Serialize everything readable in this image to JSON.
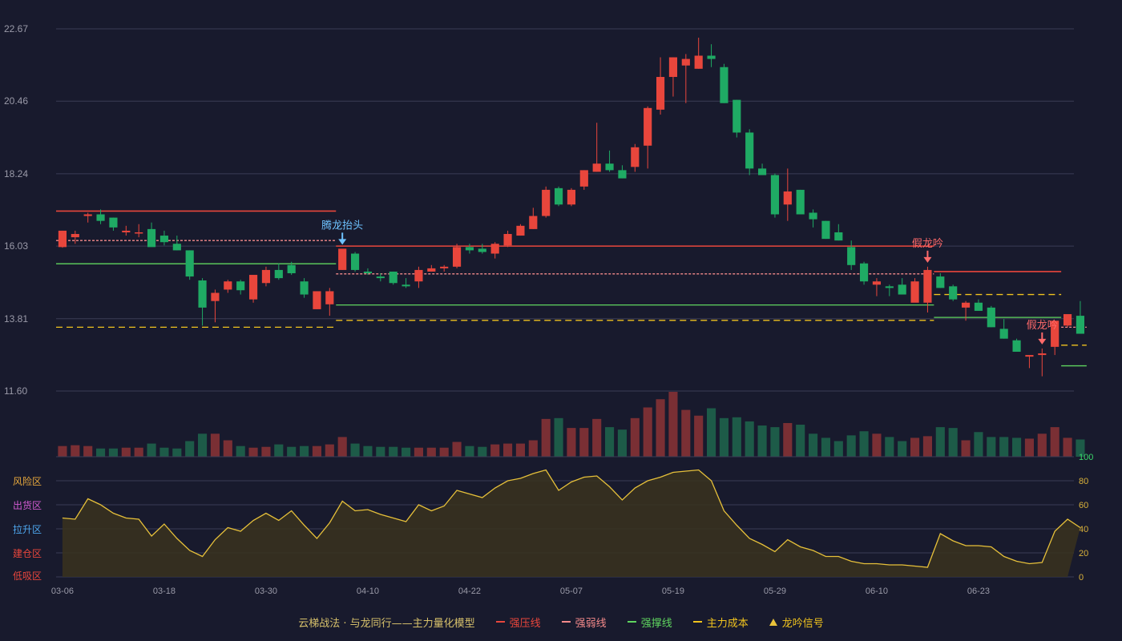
{
  "colors": {
    "background": "#181a2d",
    "grid": "#3a3c55",
    "axis_text": "#9a9aa8",
    "up": "#e8463c",
    "down": "#1faa64",
    "resist": "#e8463c",
    "weak": "#f48a8a",
    "support": "#5fd55f",
    "cost": "#f0c31e",
    "osc_line": "#e6c03a",
    "signal_blue": "#6ec3ff",
    "signal_red": "#ff6a6a"
  },
  "chart_data": {
    "type": "candlestick",
    "dates": [
      "03-06",
      "03-07",
      "03-10",
      "03-11",
      "03-12",
      "03-13",
      "03-14",
      "03-17",
      "03-18",
      "03-19",
      "03-20",
      "03-21",
      "03-24",
      "03-25",
      "03-26",
      "03-27",
      "03-28",
      "03-31",
      "04-01",
      "04-02",
      "04-03",
      "04-07",
      "04-08",
      "04-09",
      "04-10",
      "04-11",
      "04-14",
      "04-15",
      "04-16",
      "04-17",
      "04-18",
      "04-21",
      "04-22",
      "04-23",
      "04-24",
      "04-25",
      "04-28",
      "04-29",
      "04-30",
      "05-06",
      "05-07",
      "05-08",
      "05-09",
      "05-12",
      "05-13",
      "05-14",
      "05-15",
      "05-16",
      "05-19",
      "05-20",
      "05-21",
      "05-22",
      "05-23",
      "05-26",
      "05-27",
      "05-28",
      "05-29",
      "05-30",
      "06-03",
      "06-04",
      "06-05",
      "06-06",
      "06-09",
      "06-10",
      "06-11",
      "06-12",
      "06-13",
      "06-16",
      "06-17",
      "06-18",
      "06-19",
      "06-20",
      "06-23",
      "06-24",
      "06-25",
      "06-26",
      "06-27",
      "06-30",
      "07-01",
      "07-02"
    ],
    "x_tick_labels": [
      "03-06",
      "03-18",
      "03-30",
      "04-10",
      "04-22",
      "05-07",
      "05-19",
      "05-29",
      "06-10",
      "06-23"
    ],
    "x_tick_index": [
      0,
      8,
      16,
      24,
      32,
      40,
      48,
      56,
      64,
      72
    ],
    "y_tick_labels": [
      "22.67",
      "20.46",
      "18.24",
      "16.03",
      "13.81",
      "11.60"
    ],
    "ylim": [
      11.6,
      22.67
    ],
    "ohlc": [
      [
        16.0,
        16.5,
        15.98,
        16.5
      ],
      [
        16.3,
        16.5,
        16.1,
        16.4
      ],
      [
        16.95,
        17.05,
        16.75,
        17.0
      ],
      [
        17.0,
        17.15,
        16.7,
        16.8
      ],
      [
        16.9,
        16.9,
        16.5,
        16.6
      ],
      [
        16.45,
        16.65,
        16.35,
        16.5
      ],
      [
        16.45,
        16.7,
        16.3,
        16.45
      ],
      [
        16.55,
        16.75,
        16.05,
        16.0
      ],
      [
        16.15,
        16.5,
        16.05,
        16.35
      ],
      [
        16.1,
        16.35,
        15.9,
        15.9
      ],
      [
        15.9,
        15.9,
        15.0,
        15.1
      ],
      [
        14.98,
        15.05,
        13.6,
        14.15
      ],
      [
        14.35,
        14.7,
        13.7,
        14.6
      ],
      [
        14.7,
        15.0,
        14.6,
        14.95
      ],
      [
        14.95,
        15.0,
        14.55,
        14.68
      ],
      [
        14.4,
        15.1,
        14.3,
        15.15
      ],
      [
        14.9,
        15.4,
        14.8,
        15.3
      ],
      [
        15.3,
        15.5,
        15.0,
        15.05
      ],
      [
        15.45,
        15.55,
        15.15,
        15.2
      ],
      [
        14.95,
        15.05,
        14.45,
        14.55
      ],
      [
        14.1,
        14.65,
        14.1,
        14.65
      ],
      [
        14.25,
        14.75,
        13.9,
        14.65
      ],
      [
        15.3,
        15.5,
        15.3,
        15.95
      ],
      [
        15.8,
        15.85,
        15.25,
        15.3
      ],
      [
        15.25,
        15.35,
        15.15,
        15.2
      ],
      [
        15.1,
        15.2,
        14.95,
        15.05
      ],
      [
        15.25,
        15.25,
        14.85,
        14.9
      ],
      [
        14.85,
        15.05,
        14.75,
        14.8
      ],
      [
        14.95,
        15.4,
        14.75,
        15.3
      ],
      [
        15.25,
        15.45,
        15.25,
        15.35
      ],
      [
        15.35,
        15.45,
        15.25,
        15.4
      ],
      [
        15.4,
        16.1,
        15.35,
        16.0
      ],
      [
        16.0,
        16.1,
        15.8,
        15.9
      ],
      [
        15.95,
        16.1,
        15.8,
        15.85
      ],
      [
        15.8,
        16.15,
        15.65,
        16.1
      ],
      [
        16.05,
        16.5,
        16.0,
        16.4
      ],
      [
        16.35,
        16.7,
        16.35,
        16.65
      ],
      [
        16.55,
        17.2,
        16.55,
        16.95
      ],
      [
        16.95,
        17.85,
        16.9,
        17.75
      ],
      [
        17.8,
        17.85,
        17.25,
        17.3
      ],
      [
        17.3,
        17.8,
        17.25,
        17.75
      ],
      [
        17.85,
        18.35,
        17.75,
        18.35
      ],
      [
        18.3,
        19.8,
        18.3,
        18.55
      ],
      [
        18.55,
        18.95,
        18.3,
        18.35
      ],
      [
        18.35,
        18.5,
        18.1,
        18.1
      ],
      [
        18.45,
        19.15,
        18.3,
        19.05
      ],
      [
        19.1,
        20.3,
        18.4,
        20.25
      ],
      [
        20.2,
        21.8,
        20.05,
        21.2
      ],
      [
        21.2,
        21.8,
        20.6,
        21.8
      ],
      [
        21.55,
        21.9,
        20.4,
        21.75
      ],
      [
        21.45,
        22.4,
        21.45,
        21.85
      ],
      [
        21.85,
        22.2,
        21.5,
        21.75
      ],
      [
        21.5,
        21.6,
        20.4,
        20.4
      ],
      [
        20.5,
        20.5,
        19.35,
        19.5
      ],
      [
        19.5,
        19.6,
        18.2,
        18.4
      ],
      [
        18.4,
        18.55,
        18.2,
        18.2
      ],
      [
        18.2,
        18.25,
        16.9,
        17.0
      ],
      [
        17.3,
        18.4,
        16.8,
        17.7
      ],
      [
        17.75,
        17.75,
        17.0,
        17.0
      ],
      [
        17.05,
        17.15,
        16.6,
        16.85
      ],
      [
        16.8,
        16.8,
        16.25,
        16.25
      ],
      [
        16.45,
        16.7,
        16.2,
        16.2
      ],
      [
        16.0,
        16.2,
        15.3,
        15.45
      ],
      [
        15.5,
        15.55,
        14.85,
        14.95
      ],
      [
        14.85,
        15.05,
        14.5,
        14.95
      ],
      [
        14.8,
        14.85,
        14.5,
        14.75
      ],
      [
        14.85,
        15.05,
        14.55,
        14.55
      ],
      [
        14.95,
        15.05,
        14.4,
        14.3
      ],
      [
        14.3,
        15.4,
        14.0,
        15.3
      ],
      [
        15.1,
        15.2,
        14.75,
        14.75
      ],
      [
        14.8,
        14.85,
        14.35,
        14.4
      ],
      [
        14.15,
        14.35,
        13.75,
        14.3
      ],
      [
        14.3,
        14.4,
        14.05,
        14.05
      ],
      [
        14.15,
        14.2,
        13.55,
        13.55
      ],
      [
        13.5,
        13.8,
        13.2,
        13.2
      ],
      [
        13.15,
        13.2,
        12.8,
        12.8
      ],
      [
        12.7,
        12.7,
        12.3,
        12.65
      ],
      [
        12.7,
        12.9,
        12.05,
        12.75
      ],
      [
        12.95,
        13.75,
        12.7,
        13.75
      ],
      [
        13.6,
        13.8,
        13.55,
        13.95
      ],
      [
        13.9,
        14.35,
        13.75,
        13.35
      ]
    ],
    "volume": [
      13,
      14,
      13,
      10,
      10,
      11,
      11,
      16,
      11,
      10,
      19,
      28,
      28,
      20,
      13,
      11,
      12,
      15,
      12,
      13,
      13,
      15,
      24,
      16,
      13,
      12,
      12,
      11,
      11,
      11,
      11,
      18,
      13,
      12,
      15,
      16,
      16,
      20,
      46,
      47,
      35,
      35,
      46,
      36,
      33,
      47,
      60,
      70,
      79,
      57,
      50,
      59,
      47,
      48,
      43,
      38,
      36,
      41,
      39,
      28,
      23,
      19,
      26,
      31,
      28,
      24,
      19,
      23,
      25,
      36,
      35,
      20,
      30,
      24,
      24,
      23,
      22,
      28,
      36,
      23,
      21
    ],
    "volume_ylim": [
      0,
      80
    ],
    "up_flags": [
      1,
      1,
      1,
      0,
      0,
      1,
      1,
      0,
      0,
      0,
      0,
      0,
      1,
      1,
      0,
      1,
      1,
      0,
      0,
      0,
      1,
      1,
      1,
      0,
      0,
      0,
      0,
      0,
      1,
      1,
      1,
      1,
      0,
      0,
      1,
      1,
      1,
      1,
      1,
      0,
      1,
      1,
      1,
      0,
      0,
      1,
      1,
      1,
      1,
      1,
      1,
      0,
      0,
      0,
      0,
      0,
      0,
      1,
      0,
      0,
      0,
      0,
      0,
      0,
      1,
      0,
      0,
      1,
      1,
      0,
      0,
      1,
      0,
      0,
      0,
      0,
      1,
      1,
      1,
      1,
      0
    ],
    "levels": [
      {
        "kind": "resist",
        "price": 17.1,
        "from": 0,
        "to": 21,
        "style": "solid"
      },
      {
        "kind": "weak",
        "price": 16.2,
        "from": 0,
        "to": 21,
        "style": "dashed"
      },
      {
        "kind": "support",
        "price": 15.49,
        "from": 0,
        "to": 21,
        "style": "solid"
      },
      {
        "kind": "cost",
        "price": 13.55,
        "from": 0,
        "to": 21,
        "style": "dashed"
      },
      {
        "kind": "resist",
        "price": 16.03,
        "from": 22,
        "to": 68,
        "style": "solid"
      },
      {
        "kind": "weak",
        "price": 15.18,
        "from": 22,
        "to": 68,
        "style": "dashed"
      },
      {
        "kind": "support",
        "price": 14.23,
        "from": 22,
        "to": 68,
        "style": "solid"
      },
      {
        "kind": "cost",
        "price": 13.76,
        "from": 22,
        "to": 68,
        "style": "dashed"
      },
      {
        "kind": "resist",
        "price": 15.25,
        "from": 69,
        "to": 78,
        "style": "solid"
      },
      {
        "kind": "cost",
        "price": 14.55,
        "from": 69,
        "to": 78,
        "style": "dashed"
      },
      {
        "kind": "support",
        "price": 13.85,
        "from": 69,
        "to": 78,
        "style": "solid"
      },
      {
        "kind": "weak",
        "price": 13.55,
        "from": 79,
        "to": 80,
        "style": "dashed"
      },
      {
        "kind": "cost",
        "price": 13.0,
        "from": 79,
        "to": 80,
        "style": "dashed"
      },
      {
        "kind": "support",
        "price": 12.37,
        "from": 79,
        "to": 80,
        "style": "solid"
      }
    ],
    "signals": [
      {
        "index": 22,
        "label": "腾龙抬头",
        "color": "signal_blue"
      },
      {
        "index": 68,
        "label": "假龙吟",
        "color": "signal_red"
      },
      {
        "index": 77,
        "label": "假龙吟",
        "color": "signal_red"
      }
    ],
    "oscillator": {
      "ylim": [
        0,
        100
      ],
      "y_tick_labels": [
        "100",
        "80",
        "60",
        "40",
        "20",
        "0"
      ],
      "zone_labels": [
        {
          "text": "风险区",
          "color": "#e6a73c"
        },
        {
          "text": "出货区",
          "color": "#d25bd2"
        },
        {
          "text": "拉升区",
          "color": "#4ea8f0"
        },
        {
          "text": "建仓区",
          "color": "#e8463c"
        },
        {
          "text": "低吸区",
          "color": "#e8463c"
        }
      ],
      "values": [
        49,
        48,
        65,
        60,
        53,
        49,
        48,
        34,
        44,
        32,
        22,
        17,
        31,
        41,
        38,
        47,
        53,
        47,
        55,
        43,
        32,
        45,
        63,
        55,
        56,
        52,
        49,
        46,
        60,
        55,
        59,
        72,
        69,
        66,
        74,
        80,
        82,
        86,
        89,
        72,
        79,
        83,
        84,
        75,
        64,
        74,
        80,
        83,
        87,
        88,
        89,
        80,
        55,
        43,
        32,
        27,
        21,
        31,
        25,
        22,
        17,
        17,
        13,
        11,
        11,
        10,
        10,
        9,
        8,
        36,
        30,
        26,
        26,
        25,
        17,
        13,
        11,
        12,
        38,
        48,
        41
      ]
    },
    "title": "云梯战法 · 与龙同行——主力量化模型",
    "legend": [
      {
        "label": "强压线",
        "kind": "resist",
        "swatch": "line"
      },
      {
        "label": "强弱线",
        "kind": "weak",
        "swatch": "dash"
      },
      {
        "label": "强撑线",
        "kind": "support",
        "swatch": "line"
      },
      {
        "label": "主力成本",
        "kind": "cost",
        "swatch": "dash"
      },
      {
        "label": "龙吟信号",
        "kind": "signal",
        "swatch": "triangle"
      }
    ]
  }
}
